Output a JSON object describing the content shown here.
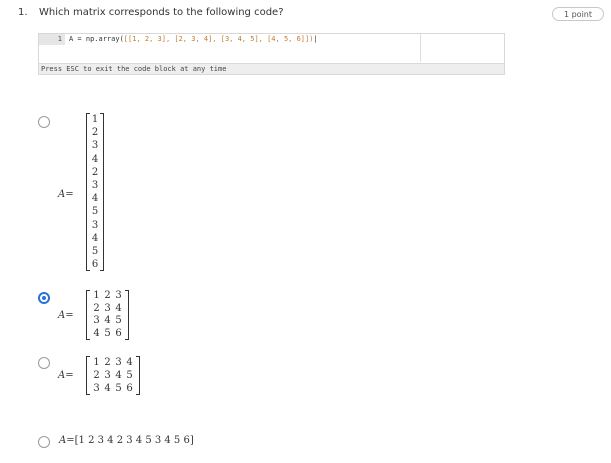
{
  "question": {
    "number": "1.",
    "text": "Which matrix corresponds to the following code?",
    "points": "1 point"
  },
  "code_block": {
    "line_number": "1",
    "code_prefix": "A = np.array(",
    "code_args": "[[1, 2, 3], [2, 3, 4], [3, 4, 5], [4, 5, 6]])",
    "hint": "Press ESC to exit the code block at any time"
  },
  "options": [
    {
      "id": "a",
      "selected": false,
      "lhs": "A",
      "eq": "=",
      "rows": [
        [
          "1"
        ],
        [
          "2"
        ],
        [
          "3"
        ],
        [
          "4"
        ],
        [
          "2"
        ],
        [
          "3"
        ],
        [
          "4"
        ],
        [
          "5"
        ],
        [
          "3"
        ],
        [
          "4"
        ],
        [
          "5"
        ],
        [
          "6"
        ]
      ]
    },
    {
      "id": "b",
      "selected": true,
      "lhs": "A",
      "eq": "=",
      "rows": [
        [
          "1",
          "2",
          "3"
        ],
        [
          "2",
          "3",
          "4"
        ],
        [
          "3",
          "4",
          "5"
        ],
        [
          "4",
          "5",
          "6"
        ]
      ]
    },
    {
      "id": "c",
      "selected": false,
      "lhs": "A",
      "eq": "=",
      "rows": [
        [
          "1",
          "2",
          "3",
          "4"
        ],
        [
          "2",
          "3",
          "4",
          "5"
        ],
        [
          "3",
          "4",
          "5",
          "6"
        ]
      ]
    },
    {
      "id": "d",
      "selected": false,
      "lhs": "A",
      "eq": "=",
      "row_text": "[1  2  3  4  2  3  4  5  3  4  5  6]"
    }
  ],
  "colors": {
    "accent": "#2b73d6",
    "code_number": "#c07a30"
  }
}
